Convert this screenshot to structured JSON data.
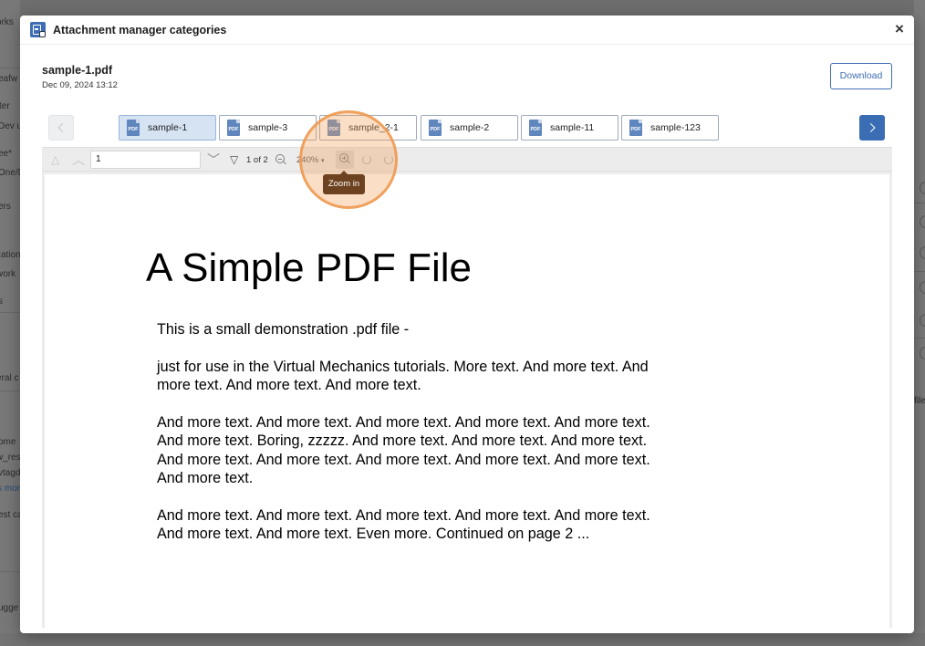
{
  "background": {
    "left_fragments": [
      "orks",
      "eafw",
      "ter",
      "Dev u",
      "ee*",
      "One/D",
      "ers",
      "zation",
      "work",
      "s",
      "eral c",
      "ome",
      "w_res",
      "vtagd",
      "s mor",
      "est ca",
      "ugge"
    ],
    "right_fragments": [
      "file"
    ]
  },
  "modal": {
    "title": "Attachment manager categories",
    "close_label": "×"
  },
  "file": {
    "name": "sample-1.pdf",
    "date": "Dec 09, 2024 13:12",
    "download_label": "Download"
  },
  "tabs": [
    {
      "label": "sample-1",
      "active": true
    },
    {
      "label": "sample-3",
      "active": false
    },
    {
      "label": "sample_2-1",
      "active": false
    },
    {
      "label": "sample-2",
      "active": false
    },
    {
      "label": "sample-11",
      "active": false
    },
    {
      "label": "sample-123",
      "active": false
    }
  ],
  "pdf_icon_label": "PDF",
  "toolbar": {
    "page_value": "1",
    "page_of": "1 of 2",
    "zoom_level": "240%",
    "zoom_caret": "▾",
    "tooltip": "Zoom in"
  },
  "document": {
    "title": "A Simple PDF File",
    "paragraphs": [
      "This is a small demonstration .pdf file -",
      "just for use in the Virtual Mechanics tutorials. More text. And more text. And more text. And more text. And more text.",
      "And more text. And more text. And more text. And more text. And more text. And more text. Boring, zzzzz. And more text. And more text. And more text. And more text. And more text. And more text. And more text. And more text. And more text.",
      "And more text. And more text. And more text. And more text. And more text. And more text. And more text. Even more. Continued on page 2 ..."
    ]
  },
  "colors": {
    "accent": "#3a6db3",
    "active_tab": "#d5e3f3",
    "highlight": "#ee964b",
    "tooltip_bg": "#6d4220"
  }
}
